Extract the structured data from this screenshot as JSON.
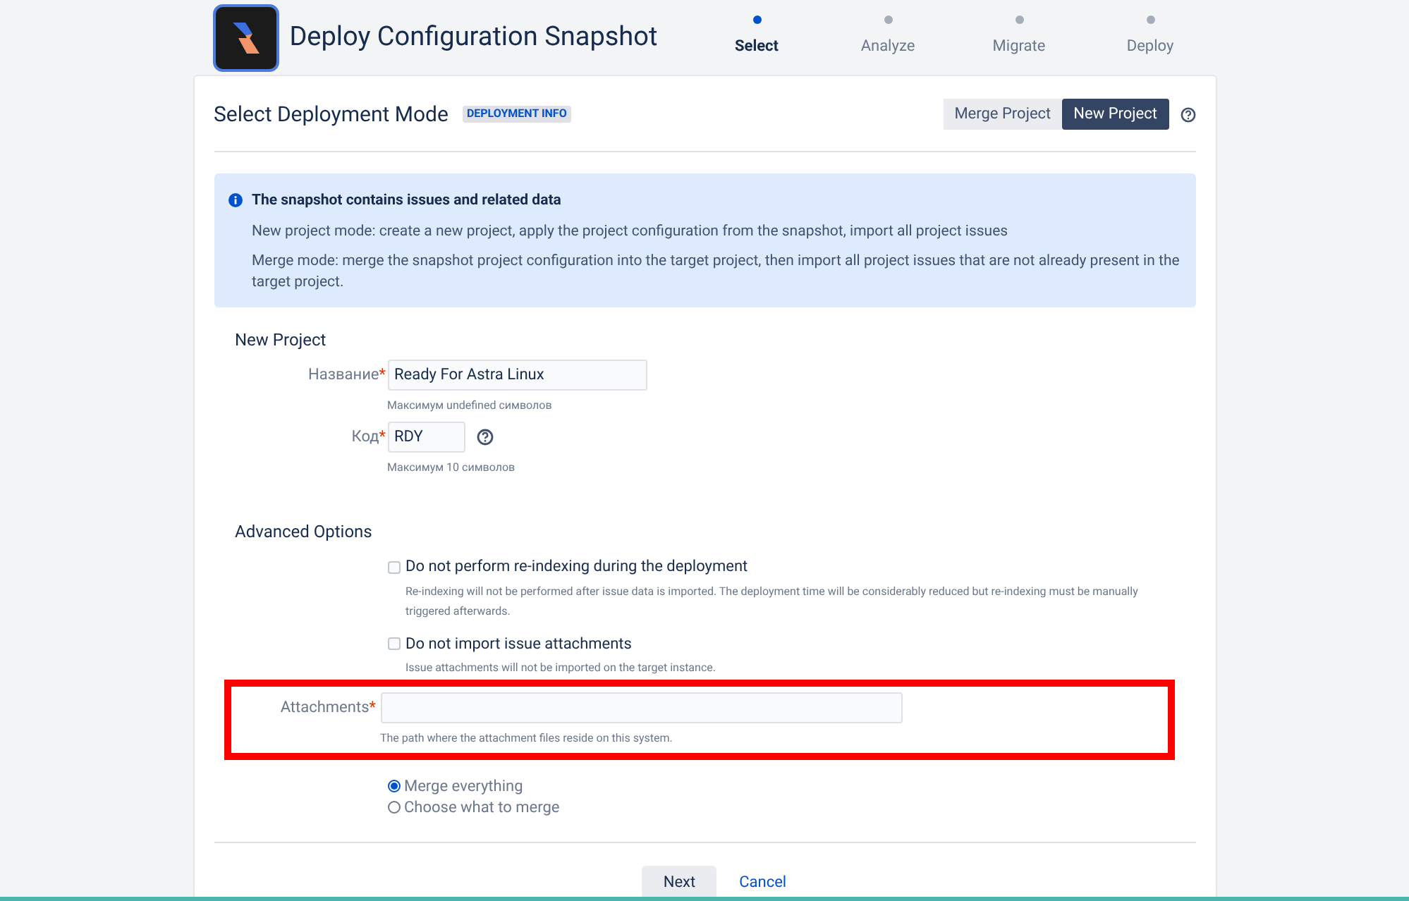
{
  "header": {
    "title": "Deploy Configuration Snapshot"
  },
  "steps": [
    {
      "label": "Select",
      "selected": true
    },
    {
      "label": "Analyze",
      "selected": false
    },
    {
      "label": "Migrate",
      "selected": false
    },
    {
      "label": "Deploy",
      "selected": false
    }
  ],
  "card": {
    "title": "Select Deployment Mode",
    "badge": "DEPLOYMENT INFO",
    "modes": [
      {
        "label": "Merge Project",
        "selected": false
      },
      {
        "label": "New Project",
        "selected": true
      }
    ]
  },
  "info": {
    "title": "The snapshot contains issues and related data",
    "lines": [
      "New project mode: create a new project, apply the project configuration from the snapshot, import all project issues",
      "Merge mode: merge the snapshot project configuration into the target project, then import all project issues that are not already present in the target project."
    ]
  },
  "new_project": {
    "title": "New Project",
    "fields": [
      {
        "label": "Название",
        "required_mark": "*",
        "value": "Ready For Astra Linux",
        "hint": "Максимум undefined символов",
        "help": false
      },
      {
        "label": "Код",
        "required_mark": "*",
        "value": "RDY",
        "hint": "Максимум 10 символов",
        "help": true
      }
    ]
  },
  "advanced": {
    "title": "Advanced Options",
    "options": [
      {
        "label": "Do not perform re-indexing during the deployment",
        "checked": false,
        "description": "Re-indexing will not be performed after issue data is imported. The deployment time will be considerably reduced but re-indexing must be manually triggered afterwards."
      },
      {
        "label": "Do not import issue attachments",
        "checked": false,
        "description": "Issue attachments will not be imported on the target instance."
      }
    ],
    "attachments": {
      "label": "Attachments",
      "required_mark": "*",
      "hint": "The path where the attachment files reside on this system.",
      "highlighted": true
    },
    "merge": [
      {
        "label": "Merge everything",
        "selected": true
      },
      {
        "label": "Choose what to merge",
        "selected": false
      }
    ]
  },
  "footer": {
    "next": "Next",
    "cancel": "Cancel"
  }
}
